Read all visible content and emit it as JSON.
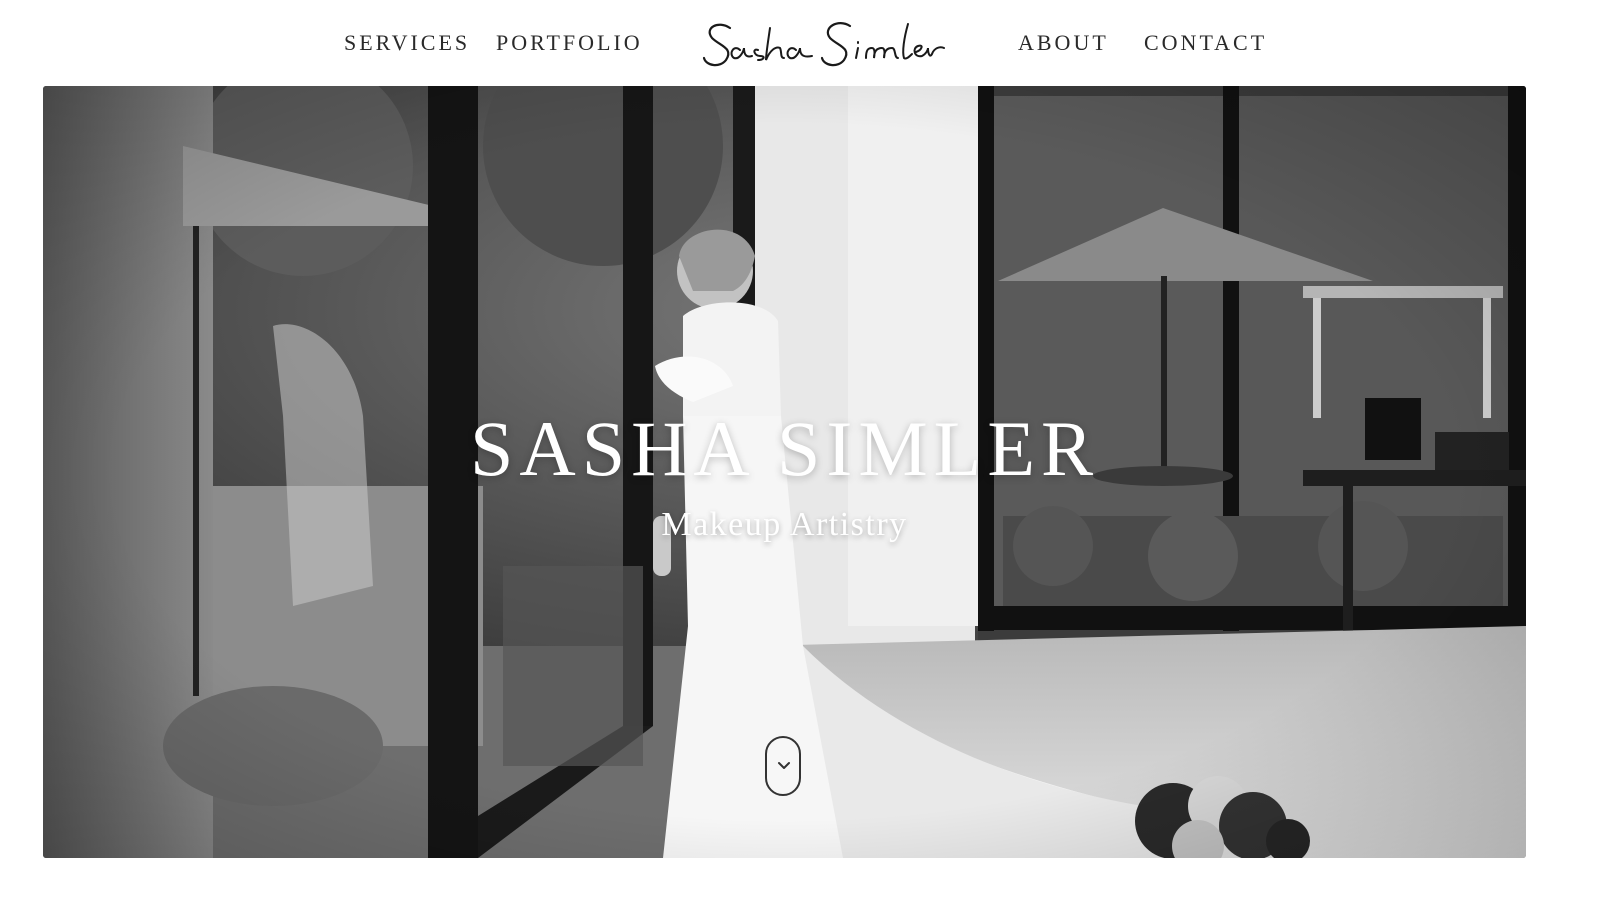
{
  "nav": {
    "items": [
      "SERVICES",
      "PORTFOLIO",
      "ABOUT",
      "CONTACT"
    ],
    "logo_text": "Sasha Simler"
  },
  "hero": {
    "title": "SASHA SIMLER",
    "subtitle": "Makeup Artistry",
    "scroll_icon": "chevron-down-icon"
  },
  "colors": {
    "text": "#2a2a2a",
    "hero_text": "#ffffff",
    "background": "#ffffff"
  }
}
